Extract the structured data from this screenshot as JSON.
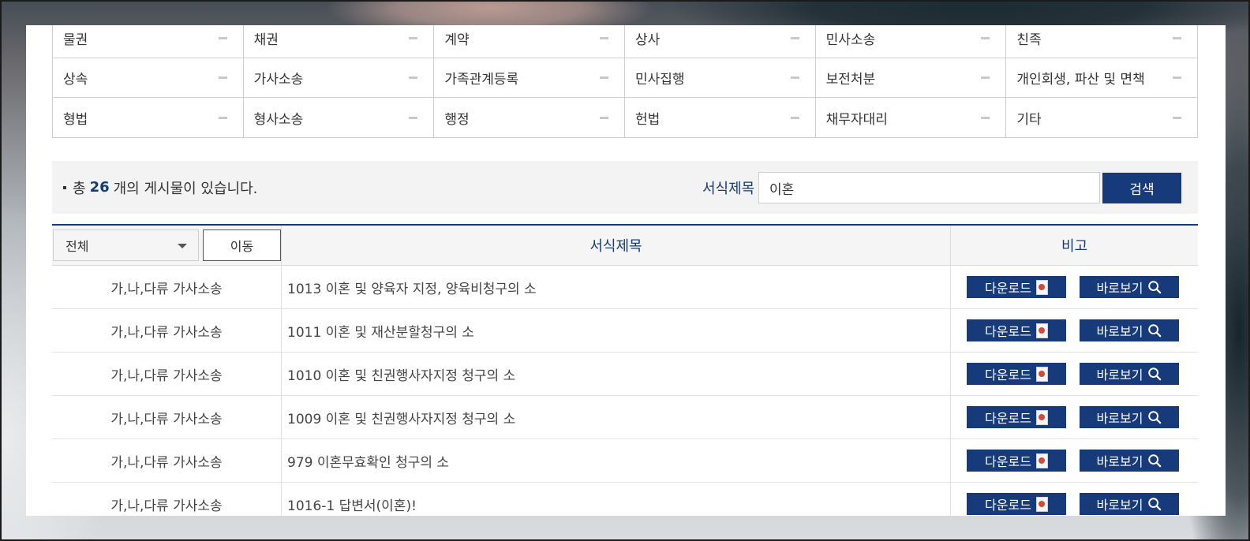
{
  "categories": [
    [
      "물권",
      "채권",
      "계약",
      "상사",
      "민사소송",
      "친족"
    ],
    [
      "상속",
      "가사소송",
      "가족관계등록",
      "민사집행",
      "보전처분",
      "개인회생, 파산 및 면책"
    ],
    [
      "형법",
      "형사소송",
      "행정",
      "헌법",
      "채무자대리",
      "기타"
    ]
  ],
  "search": {
    "count_prefix": "총",
    "count": "26",
    "count_suffix": "개의 게시물이 있습니다.",
    "label": "서식제목",
    "value": "이혼",
    "button": "검색"
  },
  "table": {
    "filter_selected": "전체",
    "move_button": "이동",
    "col_title": "서식제목",
    "col_note": "비고",
    "download_label": "다운로드",
    "view_label": "바로보기",
    "rows": [
      {
        "category": "가,나,다류 가사소송",
        "title": "1013 이혼 및 양육자 지정, 양육비청구의 소"
      },
      {
        "category": "가,나,다류 가사소송",
        "title": "1011 이혼 및 재산분할청구의 소"
      },
      {
        "category": "가,나,다류 가사소송",
        "title": "1010 이혼 및 친권행사자지정 청구의 소"
      },
      {
        "category": "가,나,다류 가사소송",
        "title": "1009 이혼 및 친권행사자지정 청구의 소"
      },
      {
        "category": "가,나,다류 가사소송",
        "title": "979 이혼무효확인 청구의 소"
      },
      {
        "category": "가,나,다류 가사소송",
        "title": "1016-1 답변서(이혼)!"
      }
    ]
  },
  "icons": {
    "download": "document-icon",
    "view": "magnifier-icon",
    "category": "minus-icon"
  },
  "colors": {
    "accent": "#163a7a",
    "header_bg": "#f5f5f5",
    "search_bg": "#f3f3f3"
  }
}
